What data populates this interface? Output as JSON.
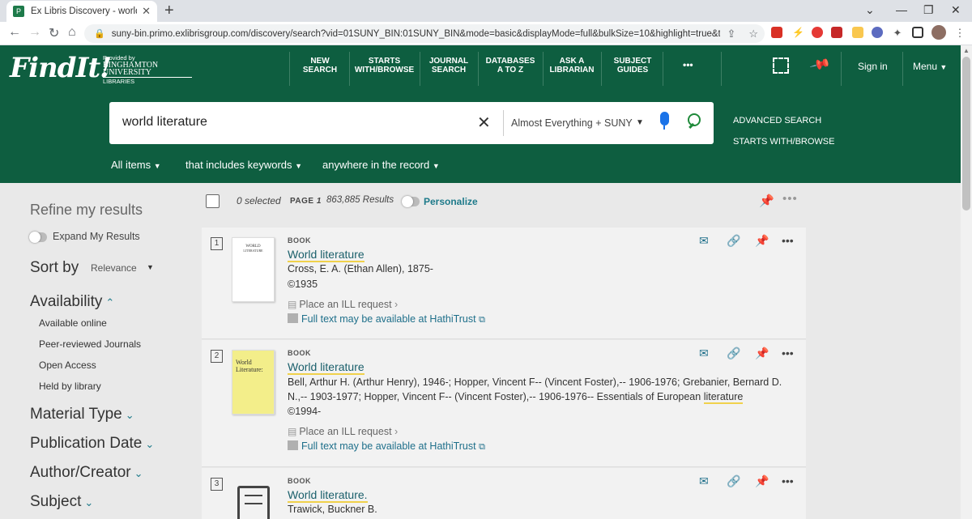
{
  "browser": {
    "tab_title": "Ex Libris Discovery - world literat",
    "url": "suny-bin.primo.exlibrisgroup.com/discovery/search?vid=01SUNY_BIN:01SUNY_BIN&mode=basic&displayMode=full&bulkSize=10&highlight=true&tab=..."
  },
  "header": {
    "logo": "FindIt!",
    "provided_by": "Provided by",
    "university": "BINGHAMTON UNIVERSITY",
    "libraries": "LIBRARIES",
    "nav": [
      {
        "line1": "NEW",
        "line2": "SEARCH"
      },
      {
        "line1": "STARTS",
        "line2": "WITH/BROWSE"
      },
      {
        "line1": "JOURNAL",
        "line2": "SEARCH"
      },
      {
        "line1": "DATABASES",
        "line2": "A TO Z"
      },
      {
        "line1": "ASK A",
        "line2": "LIBRARIAN"
      },
      {
        "line1": "SUBJECT",
        "line2": "GUIDES"
      }
    ],
    "more": "•••",
    "sign_in": "Sign in",
    "menu": "Menu"
  },
  "search": {
    "query": "world literature",
    "scope": "Almost Everything + SUNY",
    "advanced": "ADVANCED SEARCH",
    "starts_with": "STARTS WITH/BROWSE",
    "filters": [
      "All items",
      "that includes keywords",
      "anywhere in the record"
    ]
  },
  "sidebar": {
    "refine": "Refine my results",
    "expand": "Expand My Results",
    "sort_label": "Sort by",
    "sort_value": "Relevance",
    "availability": "Availability",
    "availability_items": [
      "Available online",
      "Peer-reviewed Journals",
      "Open Access",
      "Held by library"
    ],
    "facets": [
      "Material Type",
      "Publication Date",
      "Author/Creator",
      "Subject"
    ]
  },
  "toolbar": {
    "selected": "0 selected",
    "page_label": "PAGE",
    "page_num": "1",
    "results": "863,885 Results",
    "personalize": "Personalize"
  },
  "results": [
    {
      "num": "1",
      "type": "BOOK",
      "title": "World literature",
      "author": "Cross, E. A. (Ethan Allen), 1875-",
      "date": "©1935",
      "ill": "Place an ILL request",
      "hathi": "Full text may be available at HathiTrust",
      "thumb_line1": "WORLD",
      "thumb_line2": "LITERATURE"
    },
    {
      "num": "2",
      "type": "BOOK",
      "title": "World literature",
      "author_line1": "Bell, Arthur H. (Arthur Henry), 1946-; Hopper, Vincent F-- (Vincent Foster),-- 1906-1976; Grebanier, Bernard D.",
      "author_line2a": "N.,-- 1903-1977; Hopper, Vincent F-- (Vincent Foster),-- 1906-1976-- Essentials of European ",
      "author_line2b": "literature",
      "date": "©1994-",
      "ill": "Place an ILL request",
      "hathi": "Full text may be available at HathiTrust",
      "thumb_line1": "World",
      "thumb_line2": "Literature:"
    },
    {
      "num": "3",
      "type": "BOOK",
      "title": "World literature.",
      "author": "Trawick, Buckner B."
    }
  ]
}
